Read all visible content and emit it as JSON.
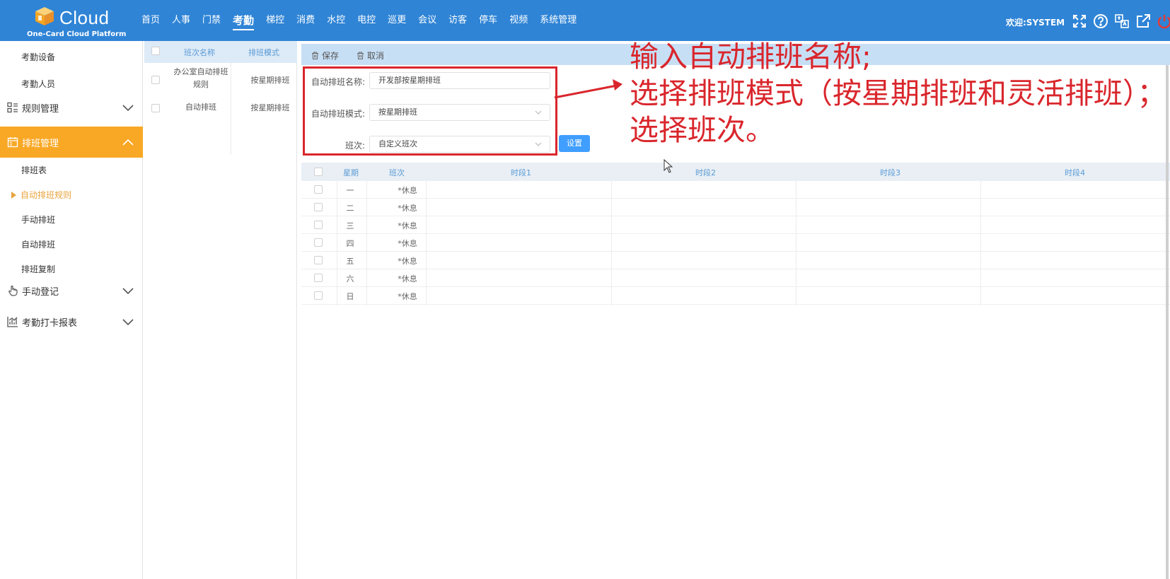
{
  "header": {
    "logo_text": "Cloud",
    "logo_sub": "One-Card Cloud Platform",
    "nav": [
      "首页",
      "人事",
      "门禁",
      "考勤",
      "梯控",
      "消费",
      "水控",
      "电控",
      "巡更",
      "会议",
      "访客",
      "停车",
      "视频",
      "系统管理"
    ],
    "active_nav": "考勤",
    "welcome": "欢迎:SYSTEM",
    "icons": [
      "fullscreen-icon",
      "help-icon",
      "translate-icon",
      "external-link-icon",
      "power-icon"
    ]
  },
  "sidebar": {
    "sub_top": [
      "考勤设备",
      "考勤人员"
    ],
    "group_rules": "规则管理",
    "group_schedule": "排班管理",
    "schedule_items": [
      "排班表",
      "自动排班规则",
      "手动排班",
      "自动排班",
      "排班复制"
    ],
    "current_item": "自动排班规则",
    "group_manual": "手动登记",
    "group_report": "考勤打卡报表"
  },
  "list": {
    "headers": [
      "班次名称",
      "排班模式"
    ],
    "rows": [
      {
        "name_line1": "办公室自动排班",
        "name_line2": "规则",
        "mode": "按星期排班"
      },
      {
        "name_line1": "自动排班",
        "name_line2": "",
        "mode": "按星期排班"
      }
    ]
  },
  "toolbar": {
    "save": "保存",
    "cancel": "取消"
  },
  "form": {
    "name_label": "自动排班名称:",
    "name_value": "开发部按星期排班",
    "mode_label": "自动排班模式:",
    "mode_value": "按星期排班",
    "shift_label": "班次:",
    "shift_value": "自定义班次",
    "set_button": "设置"
  },
  "schedule": {
    "headers": [
      "星期",
      "班次",
      "时段1",
      "时段2",
      "时段3",
      "时段4"
    ],
    "rows": [
      {
        "day": "一",
        "shift": "*休息"
      },
      {
        "day": "二",
        "shift": "*休息"
      },
      {
        "day": "三",
        "shift": "*休息"
      },
      {
        "day": "四",
        "shift": "*休息"
      },
      {
        "day": "五",
        "shift": "*休息"
      },
      {
        "day": "六",
        "shift": "*休息"
      },
      {
        "day": "日",
        "shift": "*休息"
      }
    ]
  },
  "annotation": {
    "line1": "输入自动排班名称;",
    "line2": "选择排班模式（按星期排班和灵活排班）；",
    "line3": "选择班次。"
  },
  "colors": {
    "header_bg": "#2f84d6",
    "active_group": "#f9a825",
    "annotation": "#d9262c",
    "primary_button": "#409eff"
  }
}
